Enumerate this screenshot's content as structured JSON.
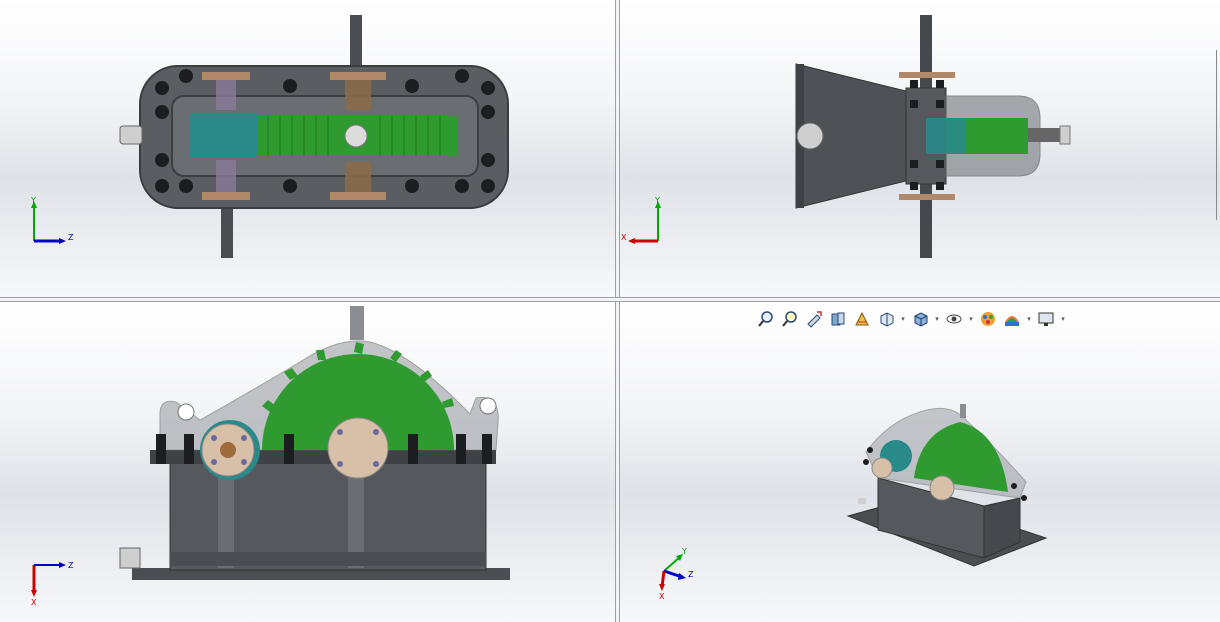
{
  "viewports": {
    "top_left": {
      "axes": {
        "y": "Y",
        "z": "Z"
      }
    },
    "top_right": {
      "axes": {
        "y": "Y",
        "x": "X"
      }
    },
    "bottom_left": {
      "axes": {
        "z": "Z",
        "x": "X"
      }
    },
    "bottom_right": {
      "axes": {
        "y": "Y",
        "z": "Z",
        "x": "X"
      }
    }
  },
  "toolbar": {
    "items": [
      "zoom-to-fit-icon",
      "zoom-to-area-icon",
      "previous-view-icon",
      "section-view-icon",
      "dynamic-annotation-icon",
      "view-orientation-icon",
      "display-style-icon",
      "hide-show-items-icon",
      "edit-appearance-icon",
      "apply-scene-icon",
      "view-settings-icon"
    ]
  },
  "colors": {
    "housing": "#55585c",
    "gear_green": "#2f9a2f",
    "pinion_teal": "#2a8a8a",
    "bronze": "#b08a68",
    "axis_x": "#cc0000",
    "axis_y": "#00aa00",
    "axis_z": "#0000cc"
  }
}
